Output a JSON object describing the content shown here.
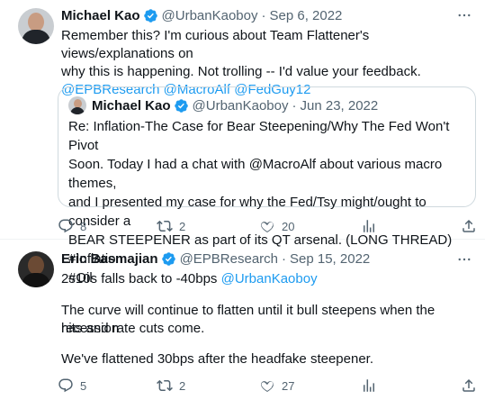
{
  "tweets": [
    {
      "author": "Michael Kao",
      "handle": "@UrbanKaoboy",
      "date": "Sep 6, 2022",
      "text_lines": [
        "Remember this? I'm curious about Team Flattener's views/explanations on",
        "why this is happening. Not trolling -- I'd value your feedback."
      ],
      "mentions": [
        "@EPBResearch",
        "@MacroAlf",
        "@FedGuy12"
      ],
      "quote": {
        "author": "Michael Kao",
        "handle": "@UrbanKaoboy",
        "date": "Jun 23, 2022",
        "text_lines": [
          "Re: Inflation-The Case for Bear Steepening/Why The Fed Won't Pivot",
          "Soon. Today I had a chat with @MacroAlf about various macro themes,",
          "and I presented my case for why the Fed/Tsy might/ought to consider a",
          "BEAR STEEPENER as part of its QT arsenal. (LONG THREAD) #Inflation",
          "#Oil"
        ]
      },
      "replies": "8",
      "retweets": "2",
      "likes": "20"
    },
    {
      "author": "Eric Basmajian",
      "handle": "@EPBResearch",
      "date": "Sep 15, 2022",
      "line1_prefix": "2s10s falls back to -40bps",
      "line1_mention": "@UrbanKaoboy",
      "para2_lines": [
        "The curve will continue to flatten until it bull steepens when the recession",
        "hits and rate cuts come."
      ],
      "para3": "We've flattened 30bps after the headfake steepener.",
      "replies": "5",
      "retweets": "2",
      "likes": "27"
    }
  ],
  "icons": {
    "verified": "verified-badge-icon",
    "more": "more-icon",
    "reply": "reply-icon",
    "retweet": "retweet-icon",
    "like": "heart-icon",
    "views": "views-icon",
    "share": "share-icon"
  },
  "colors": {
    "text": "#0f1419",
    "secondary": "#536471",
    "link": "#1d9bf0",
    "verified": "#1d9bf0",
    "border": "#cfd9de"
  }
}
